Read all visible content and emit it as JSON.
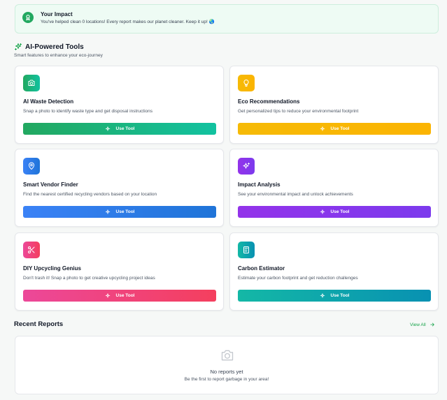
{
  "impact": {
    "title": "Your Impact",
    "text": "You've helped clean 0 locations! Every report makes our planet cleaner. Keep it up! 🌏"
  },
  "tools_section": {
    "title": "AI-Powered Tools",
    "subtitle": "Smart features to enhance your eco-journey"
  },
  "tools": [
    {
      "title": "AI Waste Detection",
      "desc": "Snap a photo to identify waste type and get disposal instructions",
      "button": "Use Tool",
      "icon": "camera-icon",
      "colors": [
        "#22a860",
        "#12c2a0"
      ]
    },
    {
      "title": "Eco Recommendations",
      "desc": "Get personalized tips to reduce your environmental footprint",
      "button": "Use Tool",
      "icon": "lightbulb-icon",
      "colors": [
        "#f6ba06",
        "#fbb402"
      ]
    },
    {
      "title": "Smart Vendor Finder",
      "desc": "Find the nearest certified recycling vendors based on your location",
      "button": "Use Tool",
      "icon": "map-pin-icon",
      "colors": [
        "#3b82f6",
        "#1f74d8"
      ]
    },
    {
      "title": "Impact Analysis",
      "desc": "See your environmental impact and unlock achievements",
      "button": "Use Tool",
      "icon": "sparkles-icon",
      "colors": [
        "#9333ea",
        "#7c3aed"
      ]
    },
    {
      "title": "DIY Upcycling Genius",
      "desc": "Don't trash it! Snap a photo to get creative upcycling project ideas",
      "button": "Use Tool",
      "icon": "scissors-icon",
      "colors": [
        "#ec4899",
        "#f43f5e"
      ]
    },
    {
      "title": "Carbon Estimator",
      "desc": "Estimate your carbon footprint and get reduction challenges",
      "button": "Use Tool",
      "icon": "calculator-icon",
      "colors": [
        "#14b8a6",
        "#0891b2"
      ]
    }
  ],
  "recent": {
    "title": "Recent Reports",
    "view_all": "View All",
    "empty_title": "No reports yet",
    "empty_sub": "Be the first to report garbage in your area!"
  }
}
